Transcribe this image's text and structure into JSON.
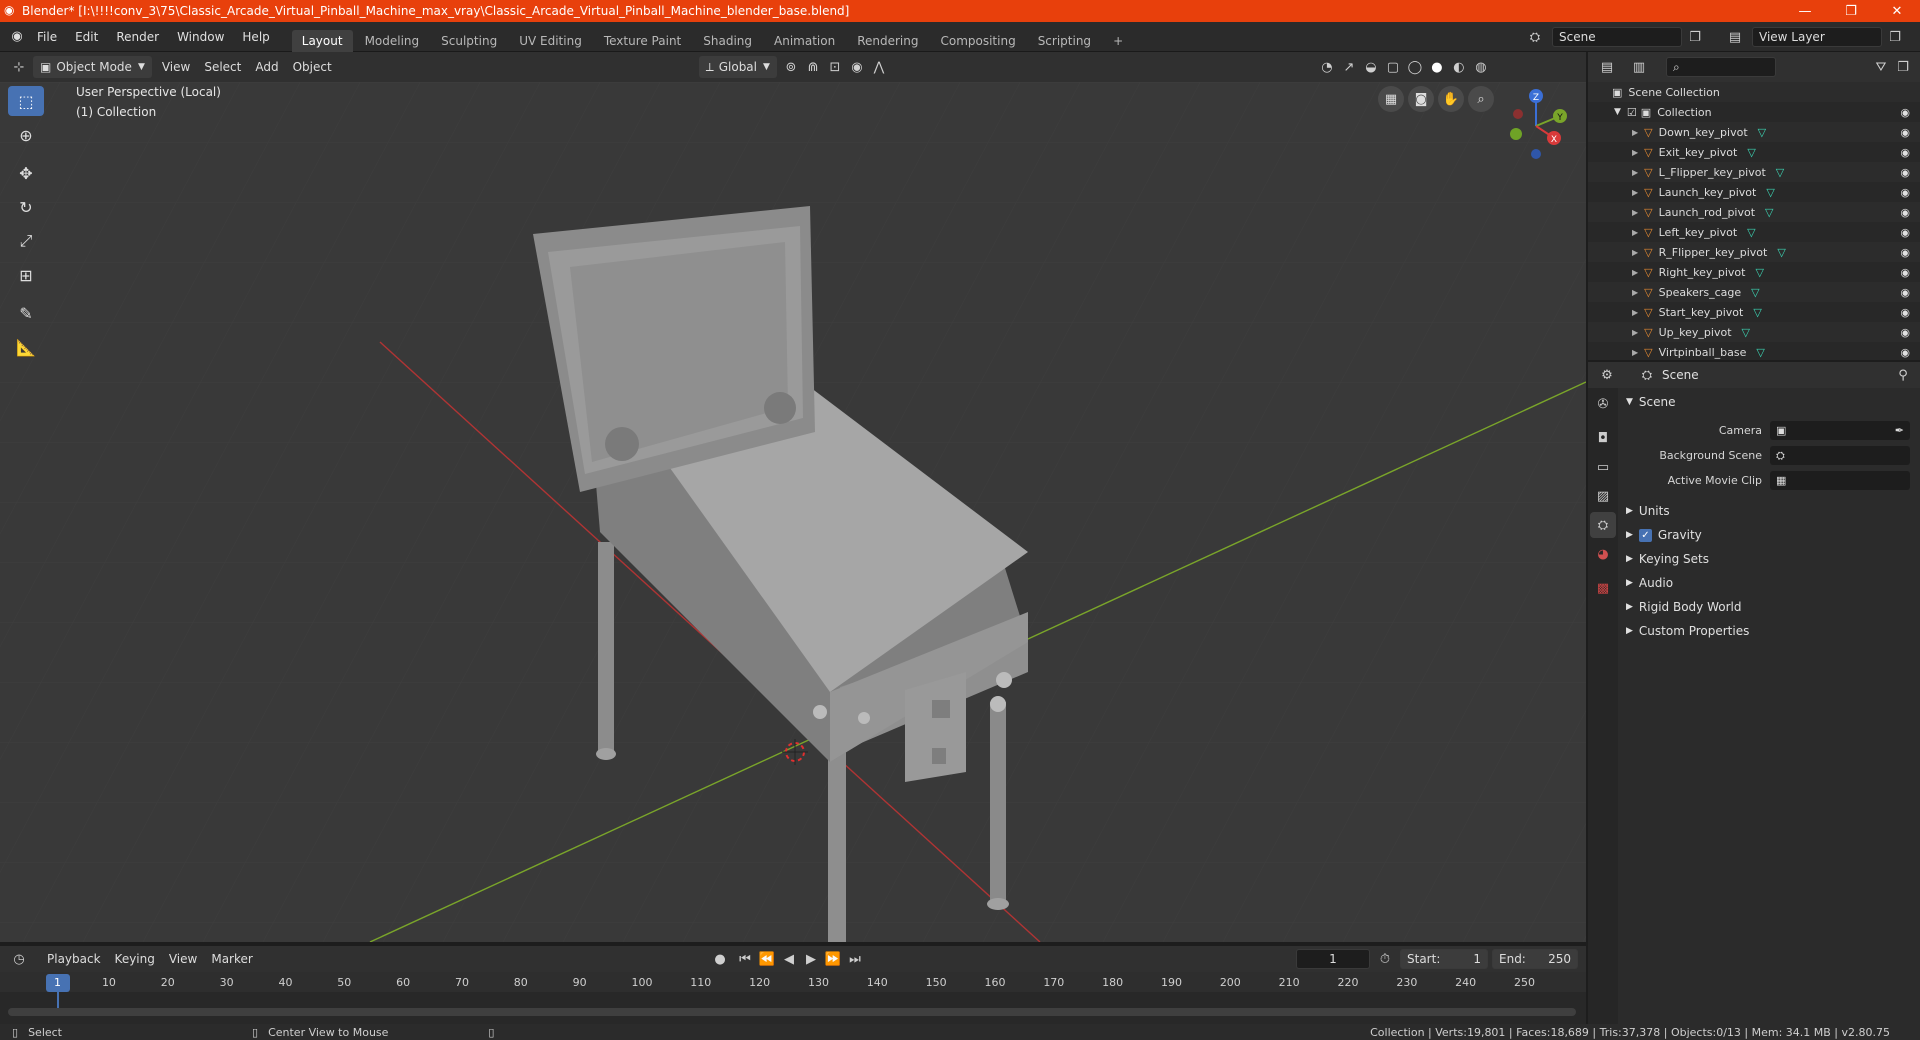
{
  "window": {
    "title": "Blender* [I:\\!!!!conv_3\\75\\Classic_Arcade_Virtual_Pinball_Machine_max_vray\\Classic_Arcade_Virtual_Pinball_Machine_blender_base.blend]",
    "minimize": "—",
    "maximize": "❐",
    "close": "✕"
  },
  "menu": {
    "items": [
      "File",
      "Edit",
      "Render",
      "Window",
      "Help"
    ],
    "workspaces": [
      "Layout",
      "Modeling",
      "Sculpting",
      "UV Editing",
      "Texture Paint",
      "Shading",
      "Animation",
      "Rendering",
      "Compositing",
      "Scripting"
    ],
    "add_workspace": "+",
    "scene_label": "Scene",
    "view_layer_label": "View Layer"
  },
  "viewport_header": {
    "mode": "Object Mode",
    "view": "View",
    "select": "Select",
    "add": "Add",
    "object": "Object",
    "orientation": "Global"
  },
  "viewport": {
    "perspective": "User Perspective (Local)",
    "collection": "(1) Collection",
    "gizmo": {
      "z": "Z",
      "y": "Y",
      "x": "X"
    }
  },
  "outliner": {
    "search_placeholder": "",
    "scene_collection": "Scene Collection",
    "collection": "Collection",
    "items": [
      "Down_key_pivot",
      "Exit_key_pivot",
      "L_Flipper_key_pivot",
      "Launch_key_pivot",
      "Launch_rod_pivot",
      "Left_key_pivot",
      "R_Flipper_key_pivot",
      "Right_key_pivot",
      "Speakers_cage",
      "Start_key_pivot",
      "Up_key_pivot",
      "Virtpinball_base"
    ]
  },
  "properties": {
    "header": "Scene",
    "section": "Scene",
    "camera_label": "Camera",
    "background_scene_label": "Background Scene",
    "active_movie_clip_label": "Active Movie Clip",
    "subpanels": [
      "Units",
      "Gravity",
      "Keying Sets",
      "Audio",
      "Rigid Body World",
      "Custom Properties"
    ],
    "gravity_checked": true
  },
  "timeline": {
    "playback": "Playback",
    "keying": "Keying",
    "view": "View",
    "marker": "Marker",
    "current_frame": "1",
    "start_label": "Start:",
    "start": "1",
    "end_label": "End:",
    "end": "250",
    "ticks": [
      "1",
      "10",
      "20",
      "30",
      "40",
      "50",
      "60",
      "70",
      "80",
      "90",
      "100",
      "110",
      "120",
      "130",
      "140",
      "150",
      "160",
      "170",
      "180",
      "190",
      "200",
      "210",
      "220",
      "230",
      "240",
      "250"
    ]
  },
  "statusbar": {
    "left": "Select",
    "middle": "Center View to Mouse",
    "stats": "Collection | Verts:19,801 | Faces:18,689 | Tris:37,378 | Objects:0/13 | Mem: 34.1 MB | v2.80.75"
  },
  "colors": {
    "title_bar": "#e8400c",
    "accent": "#4772b3",
    "viewport_bg": "#393939",
    "x_axis": "#b03434",
    "y_axis": "#7aa52a",
    "object_icon": "#e58a32",
    "mesh_icon": "#3dd6b5"
  }
}
